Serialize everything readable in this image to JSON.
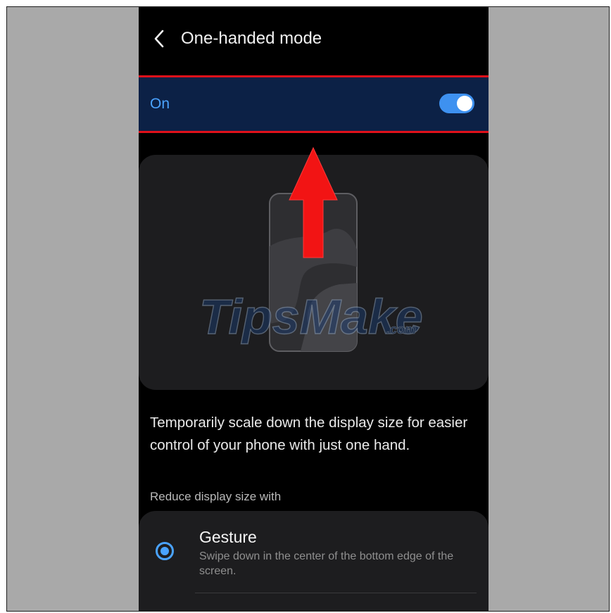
{
  "header": {
    "title": "One-handed mode",
    "back_icon": "chevron-left-icon"
  },
  "toggle": {
    "label": "On",
    "state": "on",
    "accent_color": "#3e91f0"
  },
  "annotation": {
    "arrow_icon": "up-arrow-icon",
    "highlight_color": "#e0101a"
  },
  "illustration": {
    "icon": "phone-outline-icon",
    "watermark": "TipsMake.com"
  },
  "description": "Temporarily scale down the display size for easier control of your phone with just one hand.",
  "section_label": "Reduce display size with",
  "options": [
    {
      "title": "Gesture",
      "subtitle": "Swipe down in the center of the bottom edge of the screen.",
      "selected": true
    }
  ]
}
